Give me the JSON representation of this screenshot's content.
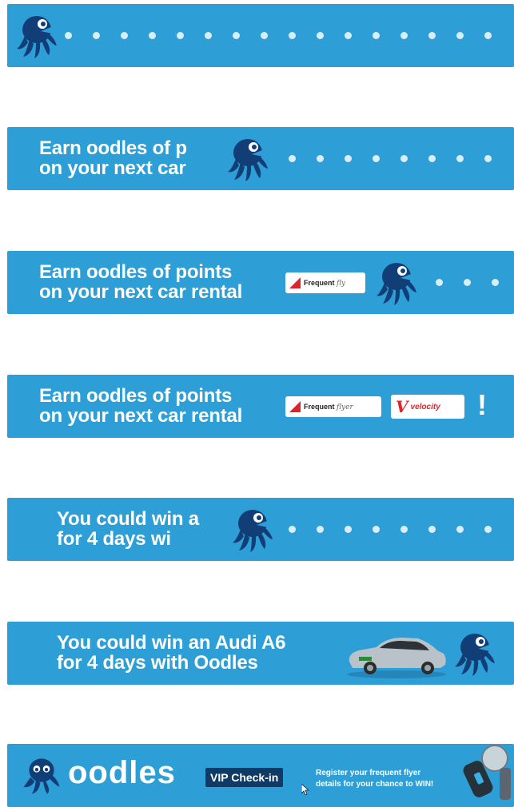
{
  "banners": {
    "b2": {
      "line1": "Earn oodles of p",
      "line2": "on your next car"
    },
    "b3": {
      "line1": "Earn oodles of points",
      "line2": "on your next car rental",
      "badge": "Frequent",
      "badge_script": "fly"
    },
    "b4": {
      "line1": "Earn oodles of points",
      "line2": "on your next car rental",
      "badge": "Frequent",
      "badge_script": "flyer",
      "velocity": "velocity",
      "exclaim": "!"
    },
    "b5": {
      "line1": "You could win a",
      "line2": "for 4 days wi"
    },
    "b6": {
      "line1": "You could win an Audi A6",
      "line2": "for 4 days with Oodles"
    },
    "b7": {
      "logo": "oodles",
      "vip": "VIP Check-in",
      "register1": "Register your frequent flyer",
      "register2": "details for your chance to WIN!"
    }
  },
  "icons": {
    "mascot": "octopus-mascot-icon",
    "car": "audi-car-icon",
    "keys": "car-keys-icon",
    "cursor": "cursor-icon"
  },
  "colors": {
    "banner": "#2e9fd6",
    "mascot": "#123e78",
    "dots": "#d9eef9",
    "vip": "#0e3a63",
    "qantas": "#d9252b"
  }
}
